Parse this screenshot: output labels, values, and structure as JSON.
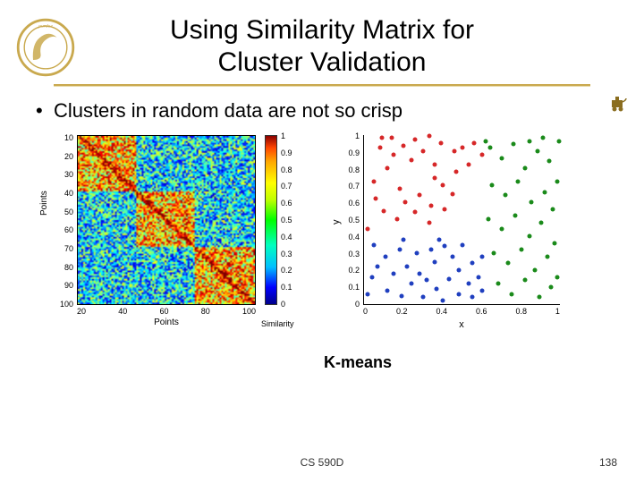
{
  "title_line1": "Using Similarity Matrix for",
  "title_line2": "Cluster Validation",
  "bullet_text": "Clusters in random data are not so crisp",
  "caption": "K-means",
  "footer": {
    "course": "CS 590D",
    "page": "138"
  },
  "chart_data": [
    {
      "type": "heatmap",
      "xlabel": "Points",
      "ylabel": "Points",
      "cb_label": "Similarity",
      "x_ticks": [
        "20",
        "40",
        "60",
        "80",
        "100"
      ],
      "y_ticks": [
        "10",
        "20",
        "30",
        "40",
        "50",
        "60",
        "70",
        "80",
        "90",
        "100"
      ],
      "cb_ticks": [
        "1",
        "0.9",
        "0.8",
        "0.7",
        "0.6",
        "0.5",
        "0.4",
        "0.3",
        "0.2",
        "0.1",
        "0"
      ],
      "value_range": [
        0,
        1
      ],
      "note": "100x100 similarity matrix of random data sorted by K-means labels; diagonal block structure weak/not crisp"
    },
    {
      "type": "scatter",
      "xlabel": "x",
      "ylabel": "y",
      "x_ticks": [
        "0",
        "0.2",
        "0.4",
        "0.6",
        "0.8",
        "1"
      ],
      "y_ticks": [
        "0",
        "0.1",
        "0.2",
        "0.3",
        "0.4",
        "0.5",
        "0.6",
        "0.7",
        "0.8",
        "0.9",
        "1"
      ],
      "xlim": [
        0,
        1
      ],
      "ylim": [
        0,
        1
      ],
      "series": [
        {
          "name": "cluster-red",
          "color": "#d62728",
          "points": [
            [
              0.08,
              0.92
            ],
            [
              0.14,
              0.98
            ],
            [
              0.12,
              0.8
            ],
            [
              0.2,
              0.93
            ],
            [
              0.26,
              0.97
            ],
            [
              0.33,
              0.99
            ],
            [
              0.05,
              0.72
            ],
            [
              0.18,
              0.68
            ],
            [
              0.24,
              0.85
            ],
            [
              0.3,
              0.9
            ],
            [
              0.36,
              0.74
            ],
            [
              0.21,
              0.6
            ],
            [
              0.28,
              0.64
            ],
            [
              0.34,
              0.58
            ],
            [
              0.4,
              0.7
            ],
            [
              0.1,
              0.55
            ],
            [
              0.17,
              0.5
            ],
            [
              0.26,
              0.54
            ],
            [
              0.33,
              0.48
            ],
            [
              0.41,
              0.56
            ],
            [
              0.06,
              0.62
            ],
            [
              0.46,
              0.9
            ],
            [
              0.5,
              0.92
            ],
            [
              0.56,
              0.95
            ],
            [
              0.6,
              0.88
            ],
            [
              0.47,
              0.78
            ],
            [
              0.53,
              0.82
            ],
            [
              0.02,
              0.44
            ],
            [
              0.15,
              0.88
            ],
            [
              0.39,
              0.95
            ],
            [
              0.45,
              0.65
            ],
            [
              0.36,
              0.82
            ],
            [
              0.09,
              0.98
            ]
          ]
        },
        {
          "name": "cluster-blue",
          "color": "#1f3fbf",
          "points": [
            [
              0.05,
              0.35
            ],
            [
              0.11,
              0.28
            ],
            [
              0.18,
              0.32
            ],
            [
              0.22,
              0.22
            ],
            [
              0.27,
              0.3
            ],
            [
              0.32,
              0.14
            ],
            [
              0.36,
              0.25
            ],
            [
              0.41,
              0.34
            ],
            [
              0.45,
              0.28
            ],
            [
              0.5,
              0.35
            ],
            [
              0.55,
              0.24
            ],
            [
              0.04,
              0.16
            ],
            [
              0.12,
              0.08
            ],
            [
              0.19,
              0.05
            ],
            [
              0.24,
              0.12
            ],
            [
              0.3,
              0.04
            ],
            [
              0.37,
              0.09
            ],
            [
              0.43,
              0.15
            ],
            [
              0.48,
              0.06
            ],
            [
              0.53,
              0.12
            ],
            [
              0.58,
              0.16
            ],
            [
              0.07,
              0.22
            ],
            [
              0.15,
              0.18
            ],
            [
              0.6,
              0.28
            ],
            [
              0.4,
              0.02
            ],
            [
              0.28,
              0.18
            ],
            [
              0.34,
              0.32
            ],
            [
              0.02,
              0.06
            ],
            [
              0.48,
              0.2
            ],
            [
              0.55,
              0.04
            ],
            [
              0.6,
              0.08
            ],
            [
              0.2,
              0.38
            ],
            [
              0.38,
              0.38
            ]
          ]
        },
        {
          "name": "cluster-green",
          "color": "#1a8a1a",
          "points": [
            [
              0.64,
              0.92
            ],
            [
              0.7,
              0.86
            ],
            [
              0.76,
              0.94
            ],
            [
              0.82,
              0.8
            ],
            [
              0.88,
              0.9
            ],
            [
              0.94,
              0.84
            ],
            [
              0.98,
              0.72
            ],
            [
              0.65,
              0.7
            ],
            [
              0.72,
              0.64
            ],
            [
              0.78,
              0.72
            ],
            [
              0.85,
              0.6
            ],
            [
              0.92,
              0.66
            ],
            [
              0.96,
              0.56
            ],
            [
              0.63,
              0.5
            ],
            [
              0.7,
              0.44
            ],
            [
              0.77,
              0.52
            ],
            [
              0.84,
              0.4
            ],
            [
              0.9,
              0.48
            ],
            [
              0.97,
              0.36
            ],
            [
              0.66,
              0.3
            ],
            [
              0.73,
              0.24
            ],
            [
              0.8,
              0.32
            ],
            [
              0.87,
              0.2
            ],
            [
              0.93,
              0.28
            ],
            [
              0.98,
              0.16
            ],
            [
              0.68,
              0.12
            ],
            [
              0.75,
              0.06
            ],
            [
              0.82,
              0.14
            ],
            [
              0.89,
              0.04
            ],
            [
              0.95,
              0.1
            ],
            [
              0.62,
              0.96
            ],
            [
              0.99,
              0.96
            ],
            [
              0.91,
              0.98
            ],
            [
              0.84,
              0.96
            ]
          ]
        }
      ]
    }
  ]
}
